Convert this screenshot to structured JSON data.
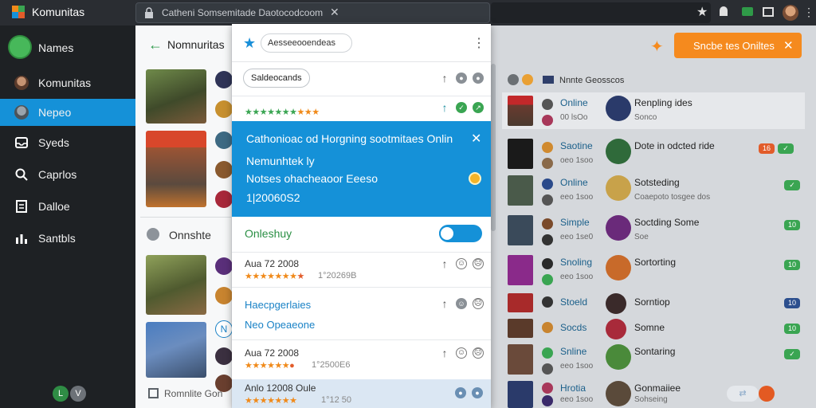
{
  "app": {
    "title": "Komunitas"
  },
  "tab": {
    "text": "Catheni Somsemitade Daotocodcoom"
  },
  "sidebar": {
    "names_label": "Names",
    "items": [
      {
        "label": "Komunitas"
      },
      {
        "label": "Nepeo"
      },
      {
        "label": "Syeds"
      },
      {
        "label": "Caprlos"
      },
      {
        "label": "Dalloe"
      },
      {
        "label": "Santbls"
      }
    ]
  },
  "leftcol": {
    "title": "Nomnuritas",
    "section2_title": "Onnshte",
    "bottom_label": "Romnlite Gon"
  },
  "popup": {
    "search_text": "Aesseeooendeas",
    "tag_chip": "Saldeocands",
    "banner": {
      "title": "Cathonioac od Horgning sootmitaes Onlin",
      "line2": "Nemunhtek ly",
      "line3": "Notses ohacheaoor Eeeso",
      "line4": "1|20060S2"
    },
    "online_title": "Onleshuy",
    "posts": [
      {
        "date": "Aua 72 2008",
        "num": "1°20269B"
      },
      {
        "date": "Aua 72 2008",
        "num": "1°2500E6"
      },
      {
        "date": "Anlo 12008 Oule",
        "num": "1°12 50"
      }
    ],
    "blue_lines": [
      "Haecpgerlaies",
      "Neo Opeaeone"
    ]
  },
  "cta": {
    "label": "Sncbe tes Oniltes"
  },
  "right": {
    "header_text": "Nnnte Geosscos",
    "rows": [
      {
        "status": "Online",
        "sub": "00 lsOo",
        "name": "Renpling ides",
        "name2": "Sonco"
      },
      {
        "status": "Saotine",
        "sub": "oeo 1soo",
        "name": "Dote in odcted ride",
        "name2": ""
      },
      {
        "status": "Online",
        "sub": "eeo 1soo",
        "name": "Sotsteding",
        "name2": "Coaepoto tosgee dos"
      },
      {
        "status": "Simple",
        "sub": "eeo 1se0",
        "name": "Soctding Some",
        "name2": "Soe"
      },
      {
        "status": "Snoling",
        "sub": "eeo 1soo",
        "name": "Sortorting",
        "name2": ""
      },
      {
        "status": "Stoeld",
        "sub": "",
        "name": "Sorntiop",
        "name2": ""
      },
      {
        "status": "Socds",
        "sub": "",
        "name": "Somne",
        "name2": ""
      },
      {
        "status": "Snline",
        "sub": "eeo 1soo",
        "name": "Sontaring",
        "name2": ""
      },
      {
        "status": "Hrotia",
        "sub": "eeo 1soo",
        "name": "Gonmaiiee",
        "name2": "Sohseing"
      }
    ]
  },
  "colors": {
    "accent_blue": "#1591d8",
    "accent_orange": "#f58a1e",
    "success_green": "#3aa552",
    "sidebar_bg": "#1e2124"
  },
  "icons": [
    "search-icon",
    "star-icon",
    "close-icon",
    "back-arrow-icon",
    "more-icon",
    "lock-icon"
  ]
}
